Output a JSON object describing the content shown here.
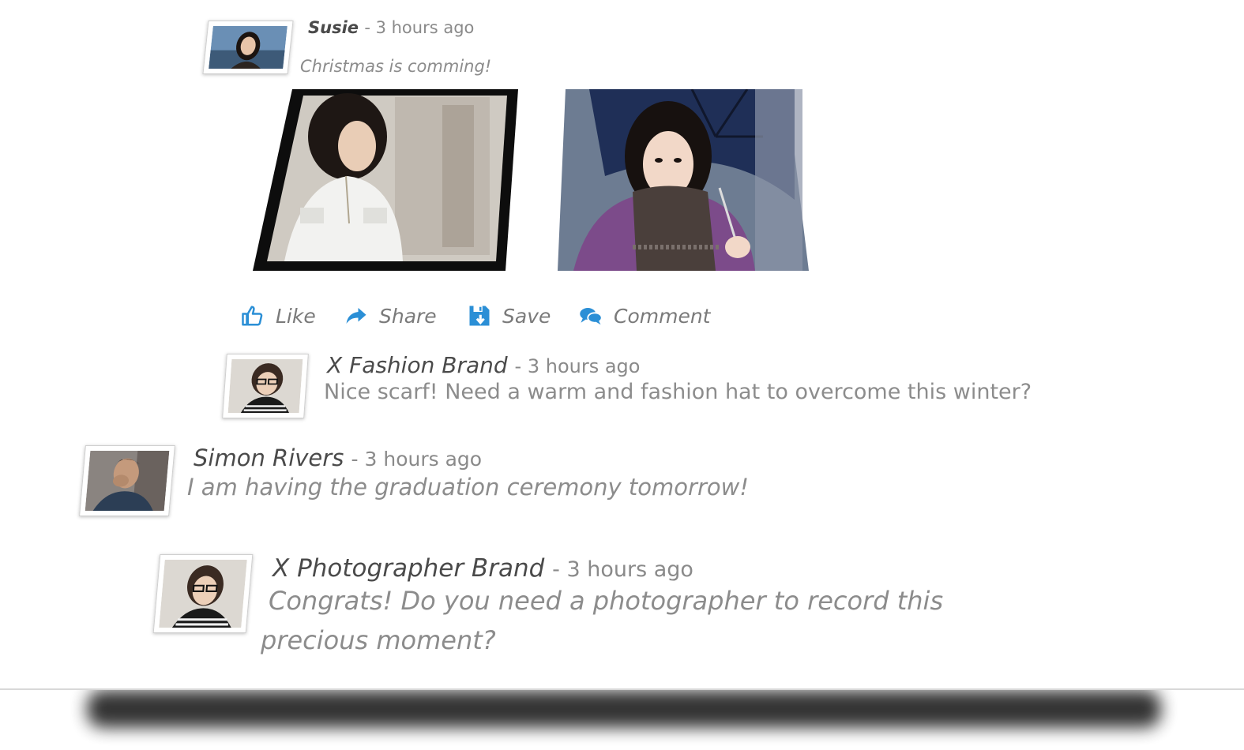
{
  "post": {
    "author": "Susie",
    "time": "- 3 hours ago",
    "text": "Christmas is comming!"
  },
  "actions": {
    "like": "Like",
    "share": "Share",
    "save": "Save",
    "comment": "Comment"
  },
  "comments": [
    {
      "author": "X Fashion Brand",
      "time": "- 3 hours ago",
      "text": "Nice scarf! Need a warm and fashion hat to overcome this winter?"
    },
    {
      "author": "Simon Rivers",
      "time": "- 3 hours ago",
      "text": "I am having the graduation ceremony tomorrow!"
    },
    {
      "author": "X Photographer Brand",
      "time": "- 3 hours ago",
      "text_line1": "Congrats! Do you need a photographer to record this",
      "text_line2": "precious moment?"
    }
  ],
  "colors": {
    "accent": "#2b8fd6",
    "name": "#4a4a4a",
    "muted": "#8c8c8c"
  },
  "icons": {
    "like": "thumbs-up-icon",
    "share": "share-arrow-icon",
    "save": "floppy-download-icon",
    "comment": "speech-bubbles-icon"
  }
}
